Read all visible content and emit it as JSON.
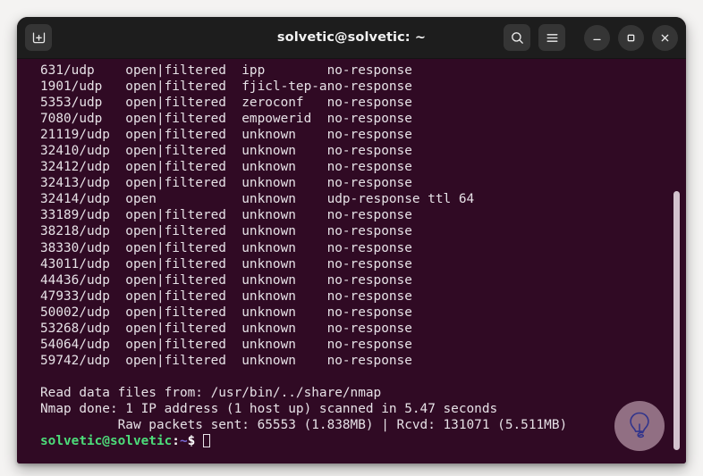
{
  "window": {
    "title": "solvetic@solvetic: ~",
    "accent_bg": "#300a24",
    "titlebar_bg": "#1d1d1d",
    "prompt_green": "#4ddd7a",
    "prompt_blue": "#7b6ad6"
  },
  "titlebar": {
    "new_tab_label": "new-tab",
    "search_label": "Search",
    "menu_label": "Main Menu",
    "minimize_label": "Minimize",
    "maximize_label": "Maximize",
    "close_label": "Close"
  },
  "terminal": {
    "header_note": "",
    "port_rows": [
      {
        "port": "631/udp",
        "state": "open|filtered",
        "service": "ipp",
        "reason": "no-response"
      },
      {
        "port": "1901/udp",
        "state": "open|filtered",
        "service": "fjicl-tep-a",
        "reason": "no-response"
      },
      {
        "port": "5353/udp",
        "state": "open|filtered",
        "service": "zeroconf",
        "reason": "no-response"
      },
      {
        "port": "7080/udp",
        "state": "open|filtered",
        "service": "empowerid",
        "reason": "no-response"
      },
      {
        "port": "21119/udp",
        "state": "open|filtered",
        "service": "unknown",
        "reason": "no-response"
      },
      {
        "port": "32410/udp",
        "state": "open|filtered",
        "service": "unknown",
        "reason": "no-response"
      },
      {
        "port": "32412/udp",
        "state": "open|filtered",
        "service": "unknown",
        "reason": "no-response"
      },
      {
        "port": "32413/udp",
        "state": "open|filtered",
        "service": "unknown",
        "reason": "no-response"
      },
      {
        "port": "32414/udp",
        "state": "open",
        "service": "unknown",
        "reason": "udp-response ttl 64"
      },
      {
        "port": "33189/udp",
        "state": "open|filtered",
        "service": "unknown",
        "reason": "no-response"
      },
      {
        "port": "38218/udp",
        "state": "open|filtered",
        "service": "unknown",
        "reason": "no-response"
      },
      {
        "port": "38330/udp",
        "state": "open|filtered",
        "service": "unknown",
        "reason": "no-response"
      },
      {
        "port": "43011/udp",
        "state": "open|filtered",
        "service": "unknown",
        "reason": "no-response"
      },
      {
        "port": "44436/udp",
        "state": "open|filtered",
        "service": "unknown",
        "reason": "no-response"
      },
      {
        "port": "47933/udp",
        "state": "open|filtered",
        "service": "unknown",
        "reason": "no-response"
      },
      {
        "port": "50002/udp",
        "state": "open|filtered",
        "service": "unknown",
        "reason": "no-response"
      },
      {
        "port": "53268/udp",
        "state": "open|filtered",
        "service": "unknown",
        "reason": "no-response"
      },
      {
        "port": "54064/udp",
        "state": "open|filtered",
        "service": "unknown",
        "reason": "no-response"
      },
      {
        "port": "59742/udp",
        "state": "open|filtered",
        "service": "unknown",
        "reason": "no-response"
      }
    ],
    "summary_lines": [
      "Read data files from: /usr/bin/../share/nmap",
      "Nmap done: 1 IP address (1 host up) scanned in 5.47 seconds",
      "          Raw packets sent: 65553 (1.838MB) | Rcvd: 131071 (5.511MB)"
    ],
    "prompt": {
      "user_host": "solvetic@solvetic",
      "colon": ":",
      "path": "~",
      "sigil": "$"
    }
  },
  "watermark": {
    "name": "solvetic-lightbulb-logo"
  }
}
